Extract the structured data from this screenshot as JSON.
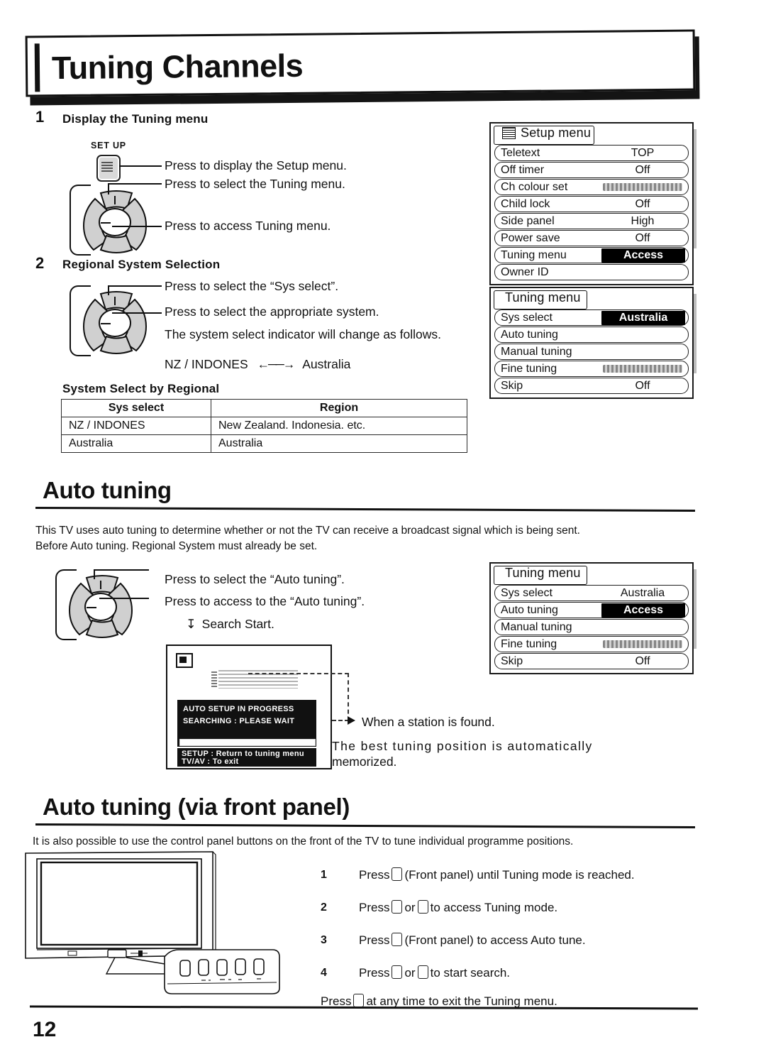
{
  "document": {
    "title": "Tuning Channels",
    "page_number": "12"
  },
  "step1": {
    "number": "1",
    "title": "Display the Tuning menu",
    "setup_button_label": "SET UP",
    "lines": [
      "Press to display the Setup menu.",
      "Press to select the Tuning menu.",
      "Press to access Tuning menu."
    ]
  },
  "setup_menu": {
    "title": "Setup menu",
    "rows": [
      {
        "label": "Teletext",
        "value": "TOP",
        "style": "text"
      },
      {
        "label": "Off timer",
        "value": "Off",
        "style": "text"
      },
      {
        "label": "Ch colour set",
        "value": "",
        "style": "gauge"
      },
      {
        "label": "Child lock",
        "value": "Off",
        "style": "text"
      },
      {
        "label": "Side panel",
        "value": "High",
        "style": "text"
      },
      {
        "label": "Power save",
        "value": "Off",
        "style": "text"
      },
      {
        "label": "Tuning menu",
        "value": "Access",
        "style": "highlight"
      },
      {
        "label": "Owner ID",
        "value": "",
        "style": "text"
      }
    ]
  },
  "step2": {
    "number": "2",
    "title": "Regional System Selection",
    "lines": [
      "Press to select the “Sys select”.",
      "Press to select the appropriate system.",
      "The system select indicator will change as follows."
    ],
    "toggle": "NZ / INDONES ⟷ Australia",
    "toggle_left": "NZ / INDONES",
    "toggle_right": "Australia"
  },
  "tuning_menu_1": {
    "title": "Tuning menu",
    "rows": [
      {
        "label": "Sys select",
        "value": "Australia",
        "style": "highlight"
      },
      {
        "label": "Auto tuning",
        "value": "",
        "style": "text"
      },
      {
        "label": "Manual tuning",
        "value": "",
        "style": "text"
      },
      {
        "label": "Fine tuning",
        "value": "",
        "style": "gauge"
      },
      {
        "label": "Skip",
        "value": "Off",
        "style": "text"
      }
    ]
  },
  "system_table": {
    "caption": "System Select by Regional",
    "headers": [
      "Sys select",
      "Region"
    ],
    "rows": [
      [
        "NZ / INDONES",
        "New Zealand. Indonesia. etc."
      ],
      [
        "Australia",
        "Australia"
      ]
    ]
  },
  "auto_tuning": {
    "heading": "Auto tuning",
    "paragraph_line1": "This TV uses auto tuning to determine whether or not the TV can receive a broadcast signal which is being sent.",
    "paragraph_line2": "Before Auto tuning. Regional System must already be set.",
    "lines": [
      "Press to select the “Auto tuning”.",
      "Press to access to the “Auto tuning”.",
      "Search Start."
    ],
    "result_caption": "When a station is found.",
    "result_line1": "The best tuning position is automatically",
    "result_line2": "memorized."
  },
  "tuning_menu_2": {
    "title": "Tuning menu",
    "rows": [
      {
        "label": "Sys select",
        "value": "Australia",
        "style": "text"
      },
      {
        "label": "Auto tuning",
        "value": "Access",
        "style": "highlight"
      },
      {
        "label": "Manual tuning",
        "value": "",
        "style": "text"
      },
      {
        "label": "Fine tuning",
        "value": "",
        "style": "gauge"
      },
      {
        "label": "Skip",
        "value": "Off",
        "style": "text"
      }
    ]
  },
  "tv_osd": {
    "status_line1": "AUTO SETUP IN PROGRESS",
    "status_line2": "SEARCHING : PLEASE WAIT",
    "help_line1": "SETUP : Return to tuning menu",
    "help_line2": "TV/AV  : To exit"
  },
  "front_panel": {
    "heading": "Auto tuning (via front panel)",
    "paragraph": "It is also possible to use the control panel buttons on the front of the TV to tune individual programme positions.",
    "steps": [
      {
        "num": "1",
        "pre": "Press",
        "mid": "",
        "post": "(Front panel) until Tuning mode is reached.",
        "buttons": 1
      },
      {
        "num": "2",
        "pre": "Press",
        "mid": "or",
        "post": "to access Tuning mode.",
        "buttons": 2
      },
      {
        "num": "3",
        "pre": "Press",
        "mid": "",
        "post": "(Front panel) to access Auto tune.",
        "buttons": 1
      },
      {
        "num": "4",
        "pre": "Press",
        "mid": "",
        "post": "to start search.",
        "buttons": 2,
        "mid2": "or"
      }
    ],
    "footer_pre": "Press",
    "footer_post": "at any time to exit the Tuning menu."
  }
}
